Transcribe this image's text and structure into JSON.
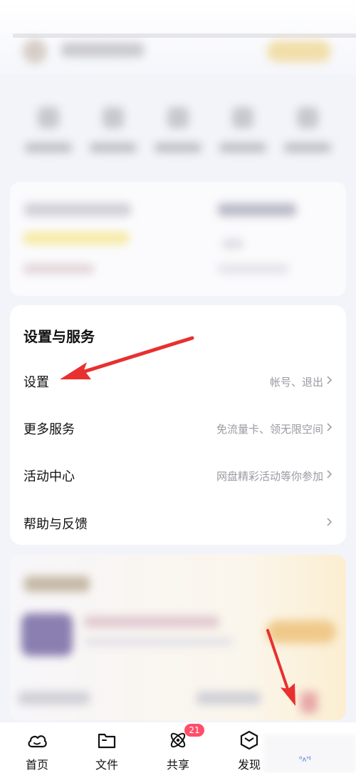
{
  "settings_section": {
    "title": "设置与服务",
    "rows": [
      {
        "label": "设置",
        "hint": "帐号、退出"
      },
      {
        "label": "更多服务",
        "hint": "免流量卡、领无限空间"
      },
      {
        "label": "活动中心",
        "hint": "网盘精彩活动等你参加"
      },
      {
        "label": "帮助与反馈",
        "hint": ""
      }
    ]
  },
  "tabbar": {
    "tabs": [
      {
        "label": "首页",
        "icon": "home-cloud-icon"
      },
      {
        "label": "文件",
        "icon": "folder-icon"
      },
      {
        "label": "共享",
        "icon": "share-atom-icon",
        "badge": "21"
      },
      {
        "label": "发现",
        "icon": "discover-cube-icon"
      }
    ]
  },
  "watermark": "ᴽᴧᴴᴶ",
  "colors": {
    "accent_red": "#e8302f",
    "badge": "#ff4d6a",
    "hint_text": "#9a9aa2"
  }
}
